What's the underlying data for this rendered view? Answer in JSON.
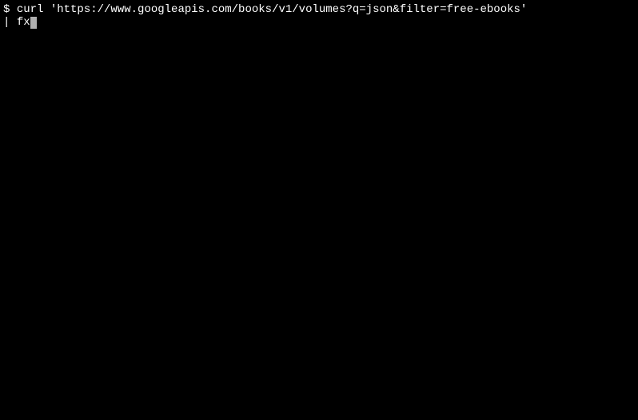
{
  "terminal": {
    "prompt": "$ ",
    "line1_command": "curl 'https://www.googleapis.com/books/v1/volumes?q=json&filter=free-ebooks'",
    "line2_pipe": "| ",
    "line2_command": "fx"
  }
}
